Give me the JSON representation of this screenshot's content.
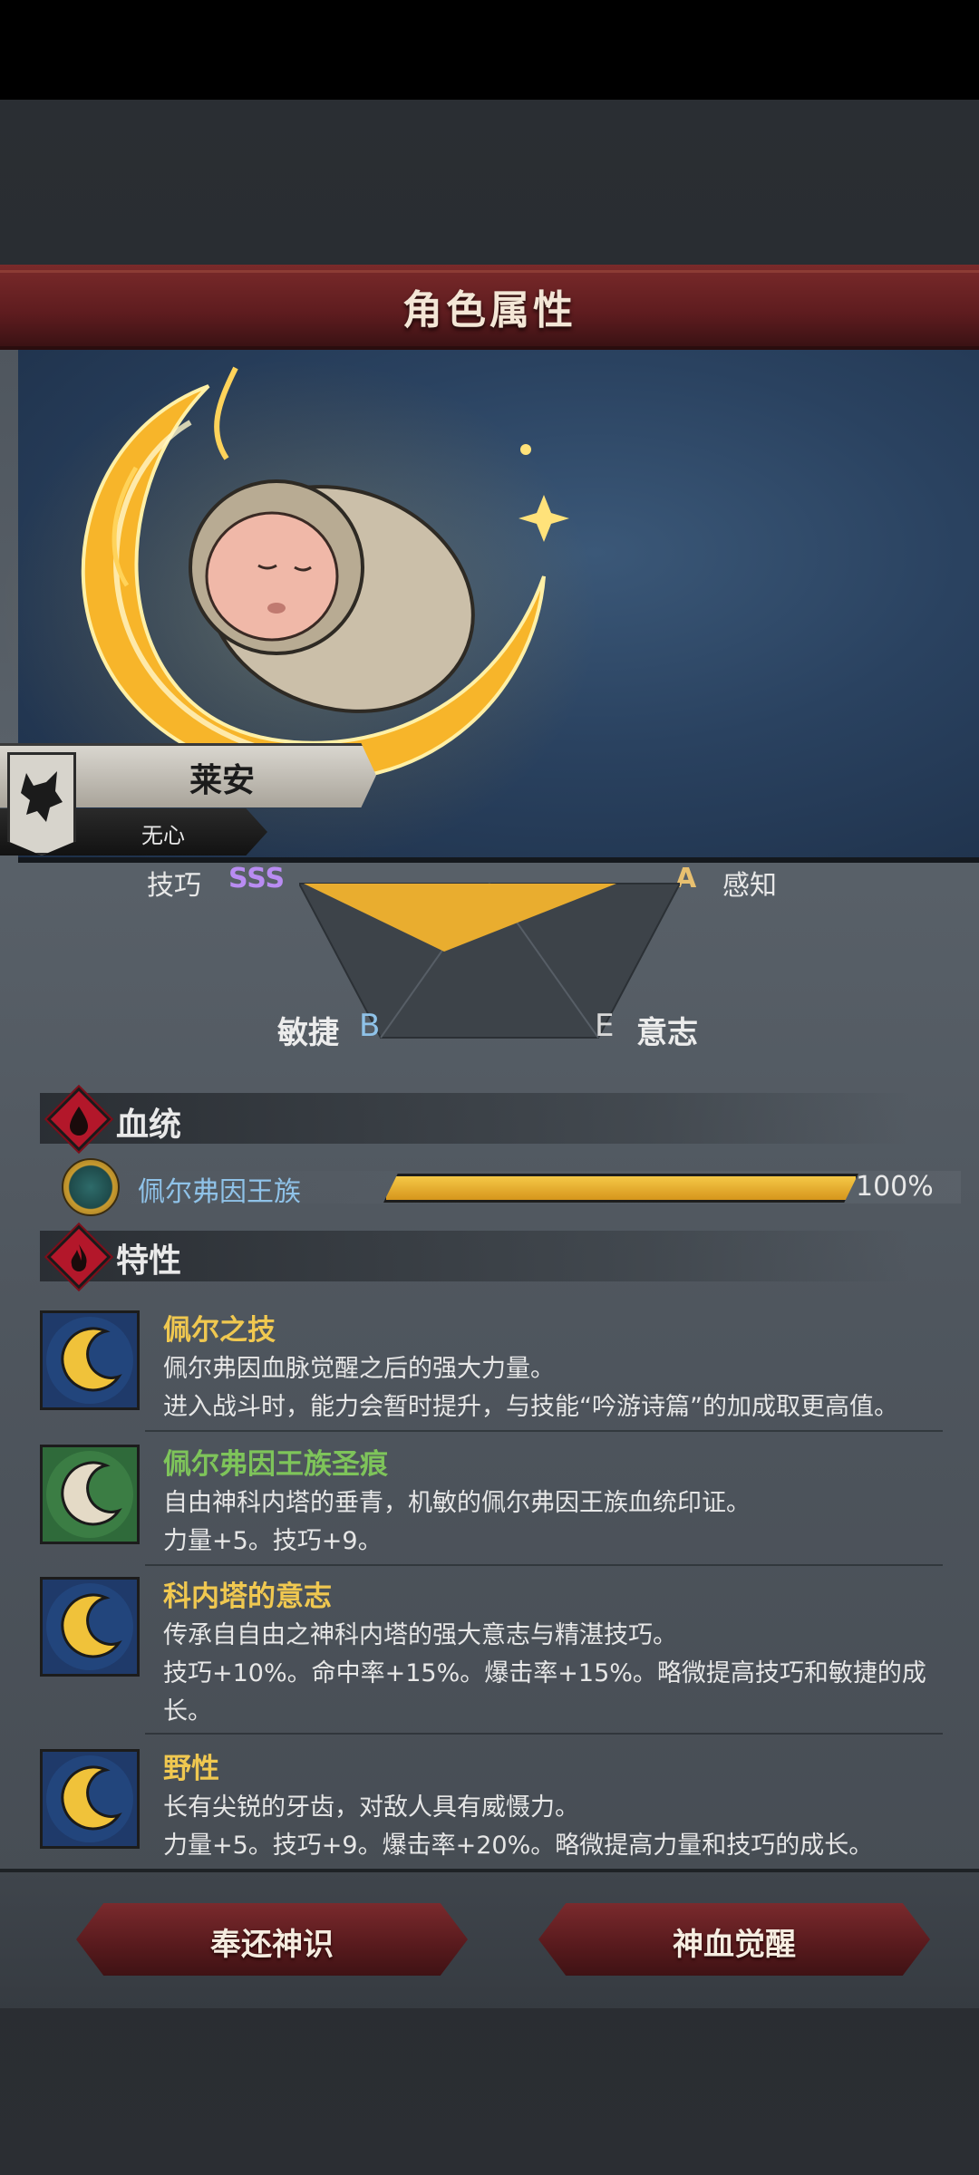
{
  "window": {
    "title": "角色属性"
  },
  "character": {
    "name": "莱安",
    "subtitle": "无心"
  },
  "stats": {
    "top_left_label": "技巧",
    "top_left_grade": "SSS",
    "top_right_grade": "A",
    "top_right_label": "感知",
    "agility_label": "敏捷",
    "agility_grade": "B",
    "will_grade": "E",
    "will_label": "意志"
  },
  "bloodline": {
    "section_title": "血统",
    "name": "佩尔弗因王族",
    "percent_text": "100%",
    "progress": 1.0
  },
  "traits": {
    "section_title": "特性",
    "items": [
      {
        "name": "佩尔之技",
        "line1": "佩尔弗因血脉觉醒之后的强大力量。",
        "line2": "进入战斗时，能力会暂时提升，与技能“吟游诗篇”的加成取更高值。",
        "line3": ""
      },
      {
        "name": "佩尔弗因王族圣痕",
        "line1": "自由神科内塔的垂青，机敏的佩尔弗因王族血统印证。",
        "line2": "力量+5。技巧+9。",
        "line3": ""
      },
      {
        "name": "科内塔的意志",
        "line1": "传承自自由之神科内塔的强大意志与精湛技巧。",
        "line2": "技巧+10%。命中率+15%。爆击率+15%。略微提高技巧和敏捷的成",
        "line3": "长。"
      },
      {
        "name": "野性",
        "line1": "长有尖锐的牙齿，对敌人具有威慑力。",
        "line2": "力量+5。技巧+9。爆击率+20%。略微提高力量和技巧的成长。",
        "line3": ""
      }
    ]
  },
  "buttons": {
    "left": "奉还神识",
    "right": "神血觉醒"
  },
  "colors": {
    "title_red": "#6a2023",
    "gold_trait": "#f0c850",
    "green_trait": "#7ec45a",
    "grade_purple": "#b98cf2",
    "grade_blue": "#8fc2e8",
    "bar_gold": "#e9b232"
  },
  "icons": {
    "wolf": "wolf-emblem-icon",
    "blood": "blood-drop-icon",
    "fire": "fire-icon",
    "moon": "crescent-moon-icon",
    "medal": "royal-medal-icon"
  }
}
